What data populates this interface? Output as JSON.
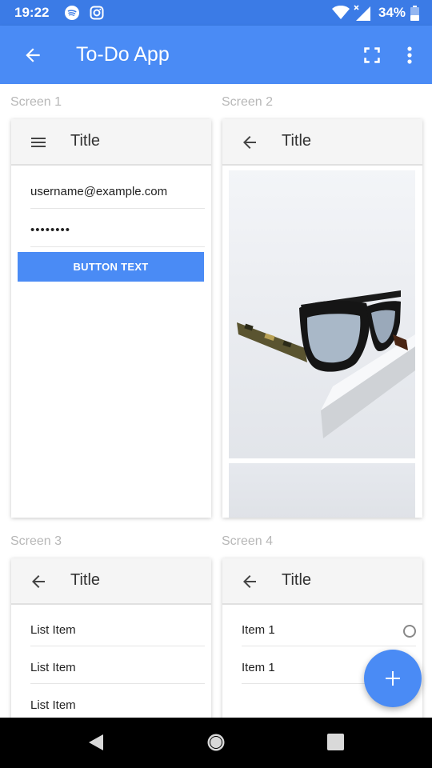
{
  "status_bar": {
    "time": "19:22",
    "battery": "34%",
    "icons": [
      "spotify-icon",
      "instagram-icon",
      "wifi-icon",
      "signal-icon",
      "battery-icon"
    ]
  },
  "app_bar": {
    "title": "To-Do App",
    "icons": [
      "back-arrow-icon",
      "fullscreen-icon",
      "more-vert-icon"
    ],
    "color": "#4a8bf5"
  },
  "screens": [
    {
      "label": "Screen 1",
      "toolbar_title": "Title",
      "toolbar_icon": "menu-icon",
      "email_value": "username@example.com",
      "password_value": "••••••••",
      "button_label": "BUTTON TEXT"
    },
    {
      "label": "Screen 2",
      "toolbar_title": "Title",
      "toolbar_icon": "back-arrow-icon",
      "image": "sunglasses-photo"
    },
    {
      "label": "Screen 3",
      "toolbar_title": "Title",
      "toolbar_icon": "back-arrow-icon",
      "items": [
        "List Item",
        "List Item",
        "List Item"
      ]
    },
    {
      "label": "Screen 4",
      "toolbar_title": "Title",
      "toolbar_icon": "back-arrow-icon",
      "items": [
        "Item 1",
        "Item 1"
      ]
    }
  ],
  "fab": {
    "icon": "plus-icon",
    "color": "#4a8bf5"
  },
  "nav_bar": {
    "icons": [
      "nav-back-icon",
      "nav-home-icon",
      "nav-recents-icon"
    ]
  }
}
